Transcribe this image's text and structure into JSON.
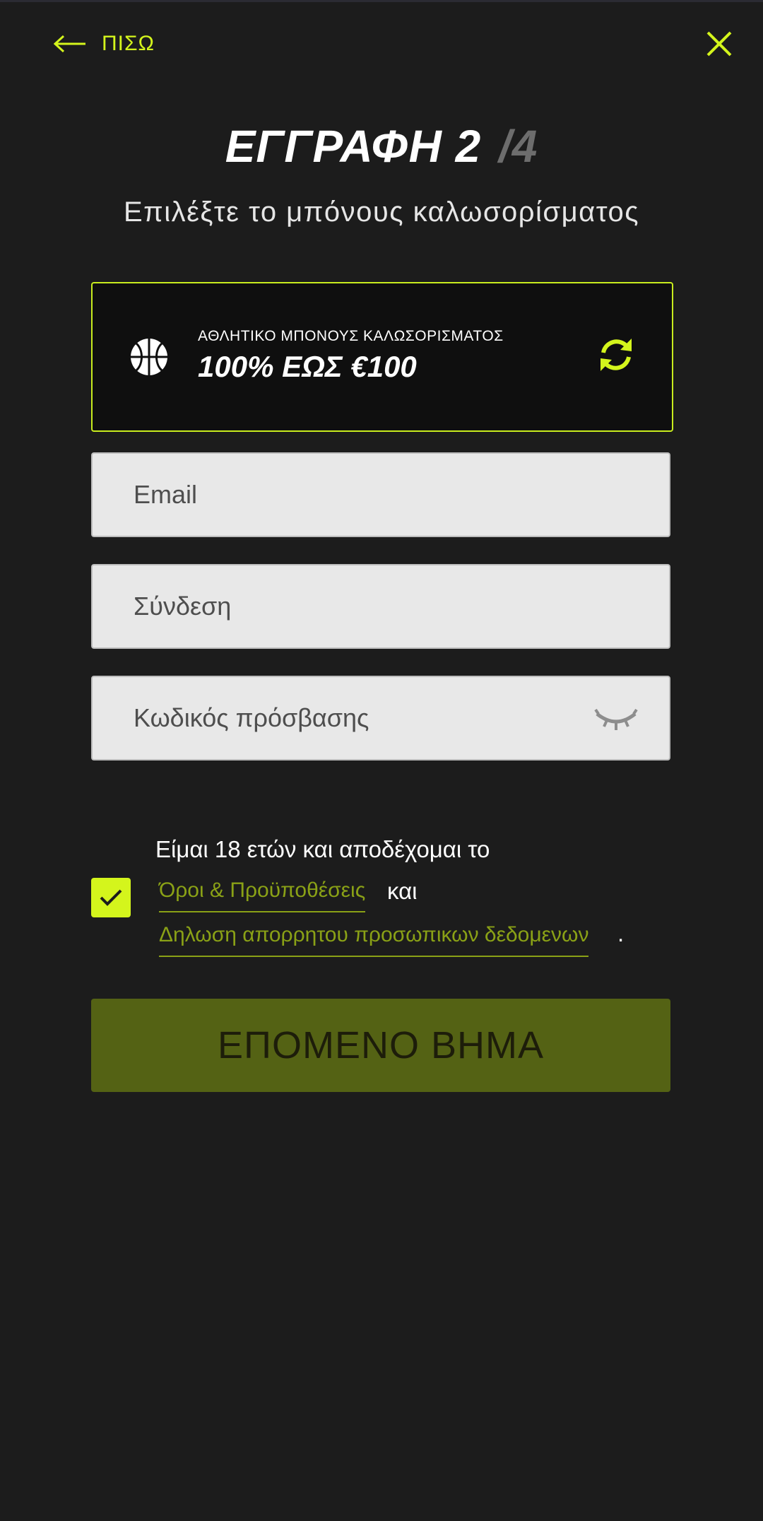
{
  "header": {
    "back_label": "ΠΙΣΩ"
  },
  "title": {
    "text": "ΕΓΓΡΑΦΗ",
    "step": "2",
    "total": "/4"
  },
  "subtitle": "Επιλέξτε το μπόνους καλωσορίσματος",
  "bonus": {
    "label": "ΑΘΛΗΤΙΚΟ ΜΠΟΝΟΥΣ ΚΑΛΩΣΟΡΙΣΜΑΤΟΣ",
    "value": "100% ΕΩΣ €100",
    "icon": "basketball-icon"
  },
  "form": {
    "email_placeholder": "Email",
    "login_placeholder": "Σύνδεση",
    "password_placeholder": "Κωδικός πρόσβασης"
  },
  "terms": {
    "checked": true,
    "text": "Είμαι 18 ετών και αποδέχομαι το",
    "terms_link": "Όροι & Προϋποθέσεις",
    "and": "και",
    "privacy_link": "Δηλωση απορρητου προσωπικων δεδομενων",
    "end": "."
  },
  "next_button": "ΕΠΟΜΕΝΟ ΒΗΜΑ",
  "colors": {
    "accent": "#d4f51c",
    "background": "#1c1c1c",
    "button_disabled": "#546214",
    "link": "#8aa116"
  }
}
